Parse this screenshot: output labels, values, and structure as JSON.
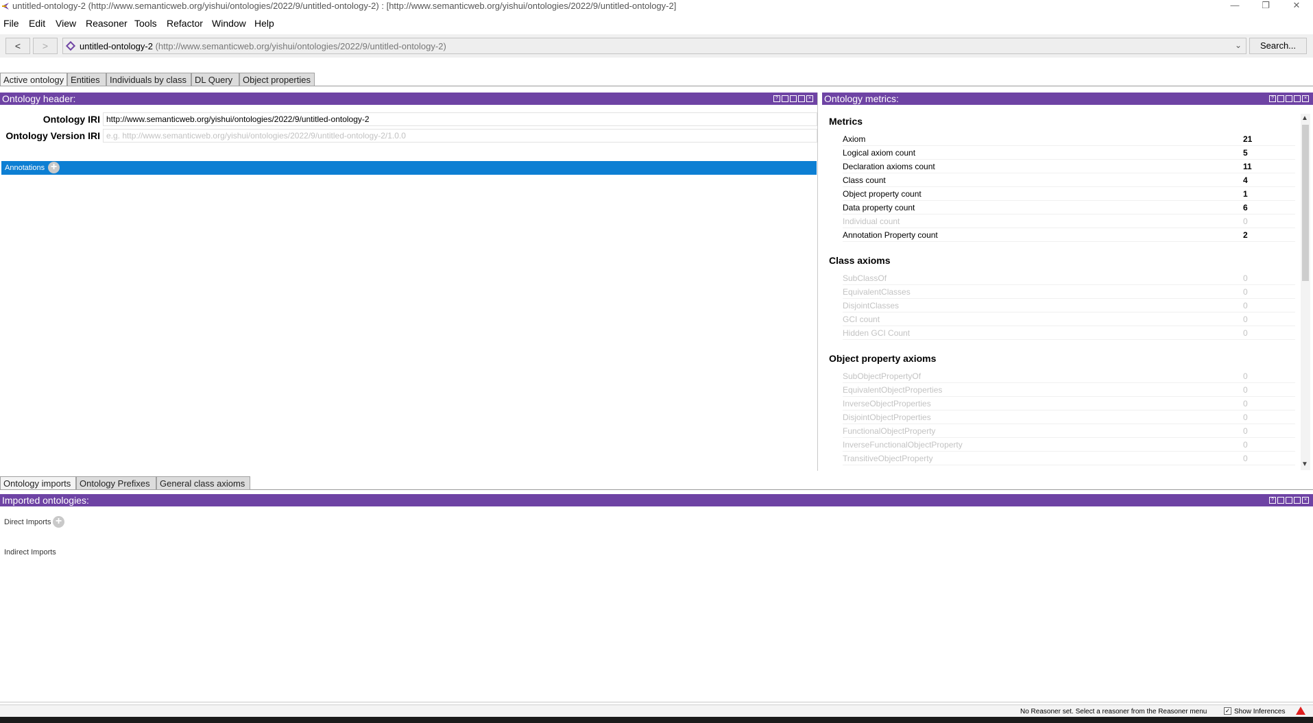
{
  "window": {
    "title": "untitled-ontology-2 (http://www.semanticweb.org/yishui/ontologies/2022/9/untitled-ontology-2)  : [http://www.semanticweb.org/yishui/ontologies/2022/9/untitled-ontology-2]",
    "minimize": "—",
    "restore": "❐",
    "close": "✕"
  },
  "menu": [
    "File",
    "Edit",
    "View",
    "Reasoner",
    "Tools",
    "Refactor",
    "Window",
    "Help"
  ],
  "nav": {
    "back": "<",
    "forward": ">",
    "ontology_name": "untitled-ontology-2",
    "ontology_uri": "(http://www.semanticweb.org/yishui/ontologies/2022/9/untitled-ontology-2)",
    "search": "Search..."
  },
  "top_tabs": [
    "Active ontology",
    "Entities",
    "Individuals by class",
    "DL Query",
    "Object properties"
  ],
  "ontology_header": {
    "title": "Ontology header:",
    "iri_label": "Ontology IRI",
    "iri_value": "http://www.semanticweb.org/yishui/ontologies/2022/9/untitled-ontology-2",
    "version_label": "Ontology Version IRI",
    "version_placeholder": "e.g. http://www.semanticweb.org/yishui/ontologies/2022/9/untitled-ontology-2/1.0.0",
    "annotations_label": "Annotations"
  },
  "metrics": {
    "title": "Ontology metrics:",
    "sections": {
      "metrics": "Metrics",
      "class_axioms": "Class axioms",
      "object_property_axioms": "Object property axioms"
    },
    "metrics_rows": [
      {
        "label": "Axiom",
        "value": "21"
      },
      {
        "label": "Logical axiom count",
        "value": "5"
      },
      {
        "label": "Declaration axioms count",
        "value": "11"
      },
      {
        "label": "Class count",
        "value": "4"
      },
      {
        "label": "Object property count",
        "value": "1"
      },
      {
        "label": "Data property count",
        "value": "6"
      },
      {
        "label": "Individual count",
        "value": "0"
      },
      {
        "label": "Annotation Property count",
        "value": "2"
      }
    ],
    "class_axiom_rows": [
      {
        "label": "SubClassOf",
        "value": "0"
      },
      {
        "label": "EquivalentClasses",
        "value": "0"
      },
      {
        "label": "DisjointClasses",
        "value": "0"
      },
      {
        "label": "GCI count",
        "value": "0"
      },
      {
        "label": "Hidden GCI Count",
        "value": "0"
      }
    ],
    "object_property_axiom_rows": [
      {
        "label": "SubObjectPropertyOf",
        "value": "0"
      },
      {
        "label": "EquivalentObjectProperties",
        "value": "0"
      },
      {
        "label": "InverseObjectProperties",
        "value": "0"
      },
      {
        "label": "DisjointObjectProperties",
        "value": "0"
      },
      {
        "label": "FunctionalObjectProperty",
        "value": "0"
      },
      {
        "label": "InverseFunctionalObjectProperty",
        "value": "0"
      },
      {
        "label": "TransitiveObjectProperty",
        "value": "0"
      }
    ]
  },
  "bottom_tabs": [
    "Ontology imports",
    "Ontology Prefixes",
    "General class axioms"
  ],
  "imports": {
    "title": "Imported ontologies:",
    "direct": "Direct Imports",
    "indirect": "Indirect Imports"
  },
  "status": {
    "message": "No Reasoner set. Select a reasoner from the Reasoner menu",
    "show_inferences": "Show Inferences",
    "checked_mark": "✓"
  },
  "colors": {
    "panel_header": "#6e43a4",
    "annotation_bar": "#0d7fd3"
  }
}
